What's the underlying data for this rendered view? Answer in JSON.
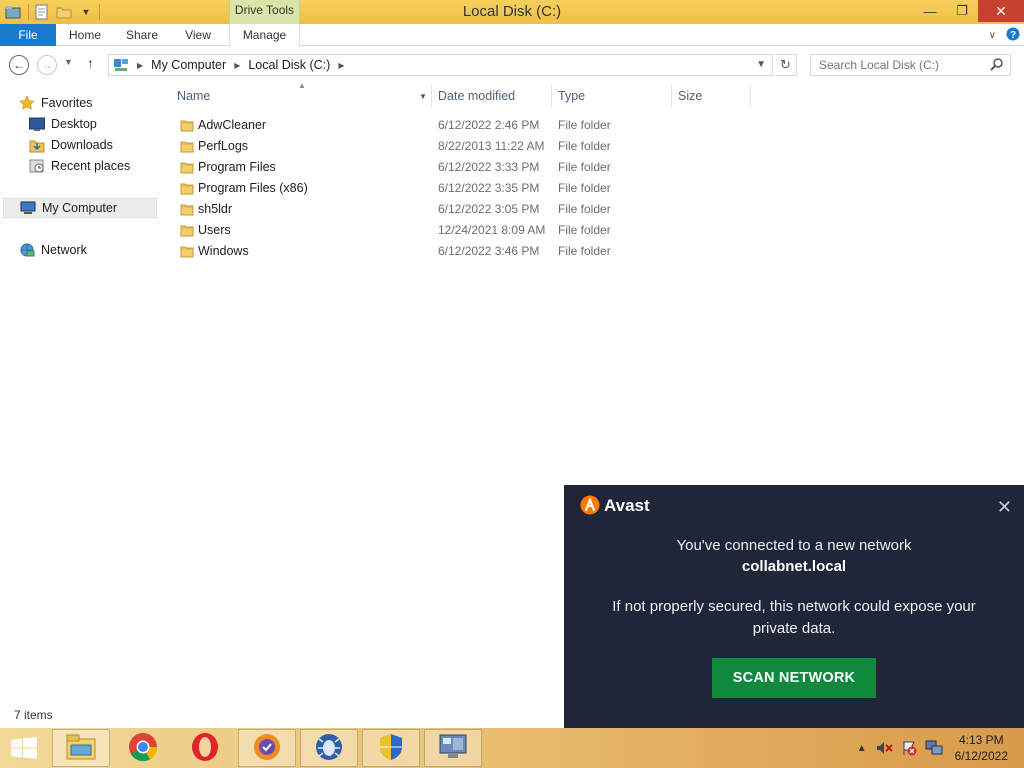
{
  "titlebar": {
    "title": "Local Disk (C:)",
    "contextual_tab": "Drive Tools",
    "minimize": "—",
    "maximize": "❐",
    "close": "✕"
  },
  "ribbon": {
    "tabs": [
      {
        "label": "File"
      },
      {
        "label": "Home"
      },
      {
        "label": "Share"
      },
      {
        "label": "View"
      },
      {
        "label": "Manage"
      }
    ]
  },
  "address": {
    "segments": [
      "My Computer",
      "Local Disk (C:)"
    ],
    "search_placeholder": "Search Local Disk (C:)"
  },
  "sidebar": {
    "favorites": "Favorites",
    "desktop": "Desktop",
    "downloads": "Downloads",
    "recent": "Recent places",
    "computer": "My Computer",
    "network": "Network"
  },
  "columns": {
    "name": "Name",
    "date": "Date modified",
    "type": "Type",
    "size": "Size"
  },
  "files": [
    {
      "name": "AdwCleaner",
      "date": "6/12/2022 2:46 PM",
      "type": "File folder"
    },
    {
      "name": "PerfLogs",
      "date": "8/22/2013 11:22 AM",
      "type": "File folder"
    },
    {
      "name": "Program Files",
      "date": "6/12/2022 3:33 PM",
      "type": "File folder"
    },
    {
      "name": "Program Files (x86)",
      "date": "6/12/2022 3:35 PM",
      "type": "File folder"
    },
    {
      "name": "sh5ldr",
      "date": "6/12/2022 3:05 PM",
      "type": "File folder"
    },
    {
      "name": "Users",
      "date": "12/24/2021 8:09 AM",
      "type": "File folder"
    },
    {
      "name": "Windows",
      "date": "6/12/2022 3:46 PM",
      "type": "File folder"
    }
  ],
  "status": {
    "items": "7 items"
  },
  "avast": {
    "brand": "Avast",
    "line1": "You've connected to a new network",
    "network": "collabnet.local",
    "line2": "If not properly secured, this network could expose your private data.",
    "button": "SCAN NETWORK",
    "accent": "#0f8a3c",
    "background": "#1e2637"
  },
  "taskbar": {
    "time": "4:13 PM",
    "date": "6/12/2022",
    "apps": [
      "file-explorer",
      "chrome",
      "opera",
      "browser",
      "bug-tool",
      "security-shield",
      "control-panel"
    ]
  },
  "colors": {
    "titlebar": "#f4c84a",
    "file_tab": "#1979ca",
    "drive_tools": "#d9e6a8"
  }
}
